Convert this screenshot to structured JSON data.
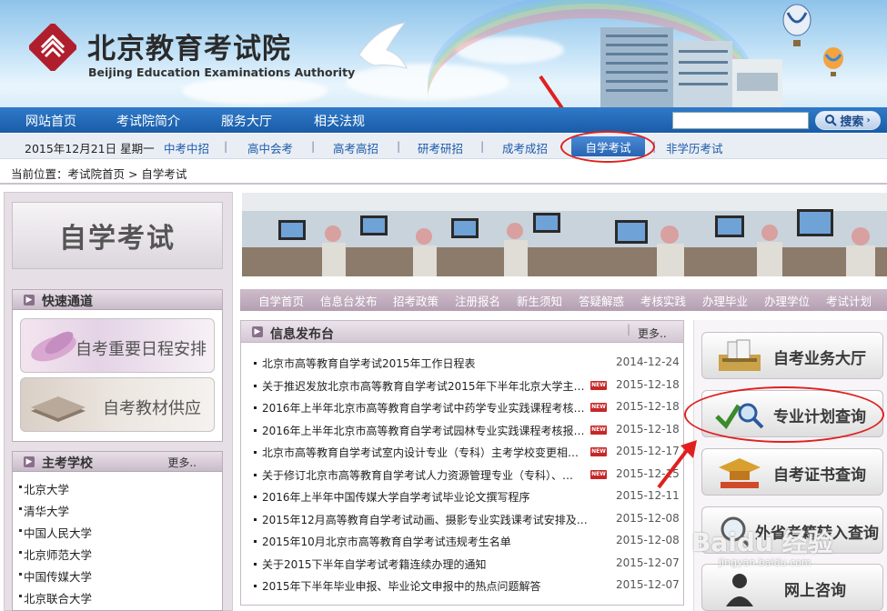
{
  "header": {
    "title_cn": "北京教育考试院",
    "title_en": "Beijing Education Examinations Authority"
  },
  "nav": {
    "items": [
      "网站首页",
      "考试院简介",
      "服务大厅",
      "相关法规"
    ],
    "search_placeholder": "",
    "search_button": "搜索"
  },
  "subnav": {
    "date": "2015年12月21日 星期一",
    "links": [
      "中考中招",
      "高中会考",
      "高考高招",
      "研考研招",
      "成考成招",
      "自学考试",
      "非学历考试"
    ],
    "active": "自学考试"
  },
  "breadcrumb": "当前位置：考试院首页 > 自学考试",
  "sidebar": {
    "title": "自学考试",
    "quick_title": "快速通道",
    "quick_links": [
      "自考重要日程安排",
      "自考教材供应"
    ],
    "schools_title": "主考学校",
    "schools_more": "更多..",
    "schools": [
      "北京大学",
      "清华大学",
      "中国人民大学",
      "北京师范大学",
      "中国传媒大学",
      "北京联合大学"
    ]
  },
  "menu": [
    "自学首页",
    "信息台发布",
    "招考政策",
    "注册报名",
    "新生须知",
    "答疑解惑",
    "考核实践",
    "办理毕业",
    "办理学位",
    "考试计划"
  ],
  "news": {
    "title": "信息发布台",
    "more": "更多..",
    "new_badge": "NEW",
    "items": [
      {
        "title": "北京市高等教育自学考试2015年工作日程表",
        "date": "2014-12-24",
        "is_new": false
      },
      {
        "title": "关于推迟发放北京市高等教育自学考试2015年下半年北京大学主…",
        "date": "2015-12-18",
        "is_new": true
      },
      {
        "title": "2016年上半年北京市高等教育自学考试中药学专业实践课程考核…",
        "date": "2015-12-18",
        "is_new": true
      },
      {
        "title": "2016年上半年北京市高等教育自学考试园林专业实践课程考核报…",
        "date": "2015-12-18",
        "is_new": true
      },
      {
        "title": "北京市高等教育自学考试室内设计专业（专科）主考学校变更相…",
        "date": "2015-12-17",
        "is_new": true
      },
      {
        "title": "关于修订北京市高等教育自学考试人力资源管理专业（专科）、…",
        "date": "2015-12-15",
        "is_new": true
      },
      {
        "title": "2016年上半年中国传媒大学自学考试毕业论文撰写程序",
        "date": "2015-12-11",
        "is_new": false
      },
      {
        "title": "2015年12月高等教育自学考试动画、摄影专业实践课考试安排及…",
        "date": "2015-12-08",
        "is_new": false
      },
      {
        "title": "2015年10月北京市高等教育自学考试违规考生名单",
        "date": "2015-12-08",
        "is_new": false
      },
      {
        "title": "关于2015下半年自学考试考籍连续办理的通知",
        "date": "2015-12-07",
        "is_new": false
      },
      {
        "title": "2015年下半年毕业申报、毕业论文申报中的热点问题解答",
        "date": "2015-12-07",
        "is_new": false
      }
    ]
  },
  "services": [
    "自考业务大厅",
    "专业计划查询",
    "自考证书查询",
    "外省考籍转入查询",
    "网上咨询"
  ],
  "watermark": {
    "main": "Baidu 经验",
    "sub": "jingyan.baidu.com"
  },
  "colors": {
    "nav_blue": "#1a5ca8",
    "highlight_red": "#e02020",
    "badge_red": "#c62828"
  }
}
